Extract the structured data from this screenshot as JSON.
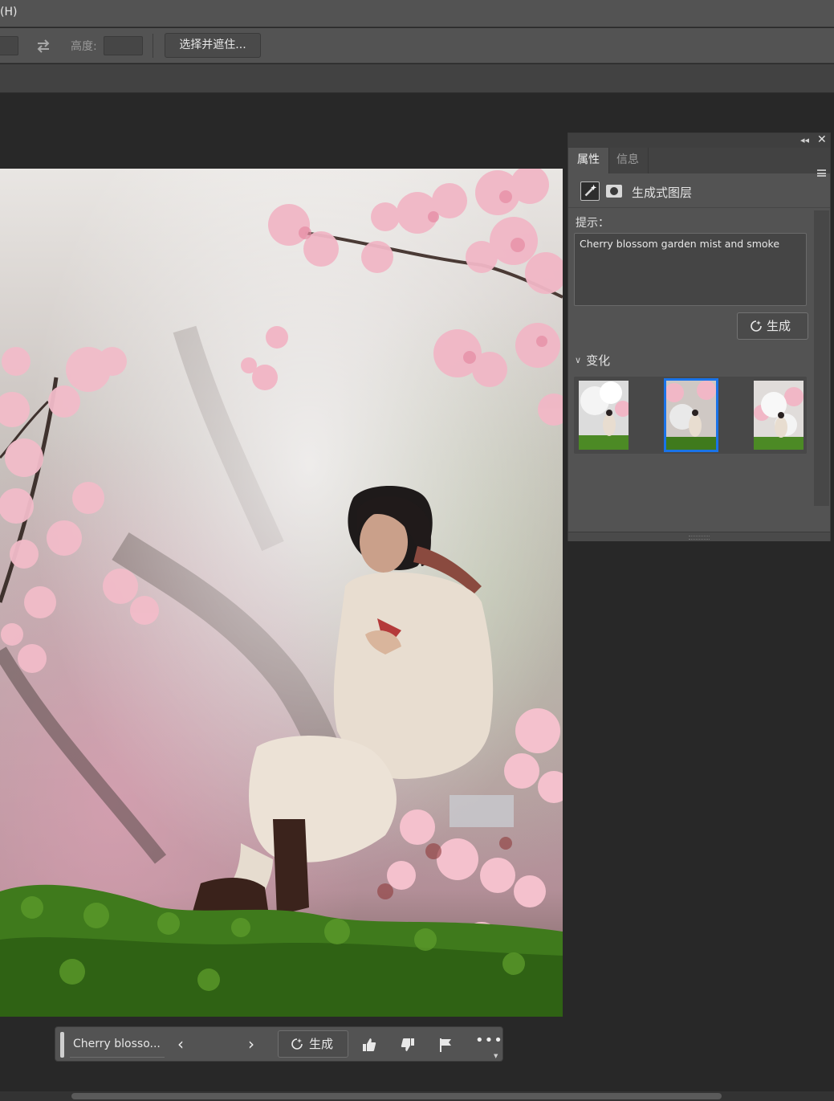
{
  "menubar": {
    "partial_item": "(H)"
  },
  "options_bar": {
    "height_label": "高度:",
    "select_and_mask_label": "选择并遮住..."
  },
  "panel": {
    "tabs": [
      "属性",
      "信息"
    ],
    "active_tab": "属性",
    "layer_type_label": "生成式图层",
    "prompt_label": "提示：",
    "prompt_text": "Cherry blossom garden mist and smoke",
    "generate_label": "生成",
    "variations_label": "变化",
    "variations_count": 3,
    "selected_variation": 2,
    "selected_color": "#1a73e8"
  },
  "taskbar": {
    "prompt_text": "Cherry blosso...",
    "generate_label": "生成",
    "icons": [
      "previous-icon",
      "next-icon",
      "thumbs-up-icon",
      "thumbs-down-icon",
      "flag-icon",
      "more-icon"
    ]
  },
  "canvas": {
    "description_colors": {
      "blossom": "#f1b7c6",
      "mist": "#e3e0dc",
      "moss": "#3f7a1c"
    }
  }
}
